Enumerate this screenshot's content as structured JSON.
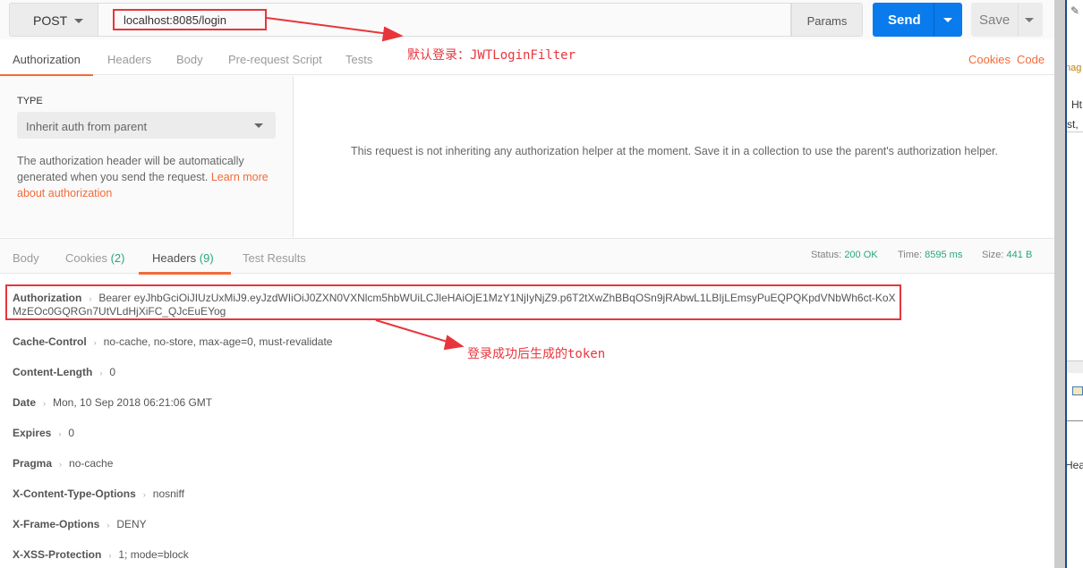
{
  "request": {
    "method": "POST",
    "url": "localhost:8085/login",
    "params_label": "Params",
    "send_label": "Send",
    "save_label": "Save"
  },
  "tabs": [
    "Authorization",
    "Headers",
    "Body",
    "Pre-request Script",
    "Tests"
  ],
  "links": {
    "cookies": "Cookies",
    "code": "Code"
  },
  "auth": {
    "type_label": "TYPE",
    "type_value": "Inherit auth from parent",
    "help_text": "The authorization header will be automatically generated when you send the request. ",
    "learn_more": "Learn more about authorization",
    "notice": "This request is not inheriting any authorization helper at the moment. Save it in a collection to use the parent's authorization helper."
  },
  "response_tabs": [
    {
      "label": "Body"
    },
    {
      "label": "Cookies",
      "count": "(2)"
    },
    {
      "label": "Headers",
      "count": "(9)"
    },
    {
      "label": "Test Results"
    }
  ],
  "status": {
    "status_label": "Status:",
    "status_value": "200 OK",
    "time_label": "Time:",
    "time_value": "8595 ms",
    "size_label": "Size:",
    "size_value": "441 B"
  },
  "headers": [
    {
      "key": "Authorization",
      "value": "Bearer eyJhbGciOiJIUzUxMiJ9.eyJzdWIiOiJ0ZXN0VXNlcm5hbWUiLCJleHAiOjE1MzY1NjIyNjZ9.p6T2tXwZhBBqOSn9jRAbwL1LBIjLEmsyPuEQPQKpdVNbWh6ct-KoXMzEOc0GQRGn7UtVLdHjXiFC_QJcEuEYog"
    },
    {
      "key": "Cache-Control",
      "value": "no-cache, no-store, max-age=0, must-revalidate"
    },
    {
      "key": "Content-Length",
      "value": "0"
    },
    {
      "key": "Date",
      "value": "Mon, 10 Sep 2018 06:21:06 GMT"
    },
    {
      "key": "Expires",
      "value": "0"
    },
    {
      "key": "Pragma",
      "value": "no-cache"
    },
    {
      "key": "X-Content-Type-Options",
      "value": "nosniff"
    },
    {
      "key": "X-Frame-Options",
      "value": "DENY"
    },
    {
      "key": "X-XSS-Protection",
      "value": "1; mode=block"
    }
  ],
  "annotations": {
    "login_note": "默认登录：JWTLoginFilter",
    "token_note": "登录成功后生成的token",
    "color": "#e8353b"
  },
  "side_window": {
    "texts": [
      "nag",
      "Ht",
      "st,",
      "Hea"
    ]
  },
  "colors": {
    "accent": "#f26b3a",
    "send": "#097bed",
    "status_ok": "#27a780"
  }
}
